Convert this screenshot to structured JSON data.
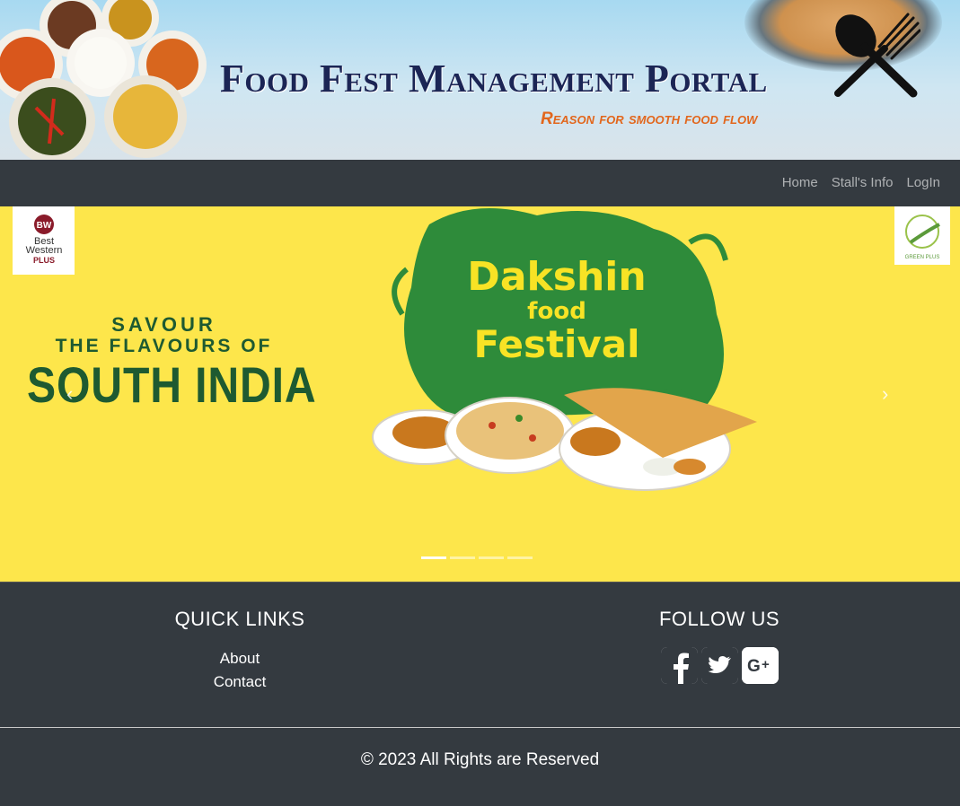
{
  "header": {
    "title": "Food Fest Management Portal",
    "subtitle": "Reason for smooth food flow"
  },
  "nav": {
    "items": [
      {
        "label": "Home"
      },
      {
        "label": "Stall's Info"
      },
      {
        "label": "LogIn"
      }
    ]
  },
  "carousel": {
    "left_logo_text": [
      "BW",
      "Best",
      "Western",
      "PLUS"
    ],
    "right_logo_text": "GREEN PLUS",
    "headline": {
      "line1": "SAVOUR",
      "line2": "THE FLAVOURS OF",
      "line3": "SOUTH INDIA"
    },
    "festival": {
      "word1": "Dakshin",
      "word2": "food",
      "word3": "Festival"
    },
    "prev_label": "‹",
    "next_label": "›",
    "slide_count": 4,
    "active_slide": 1,
    "colors": {
      "background": "#fde64b",
      "headline": "#1e5a31",
      "splash": "#2e8b3a"
    }
  },
  "footer": {
    "quick_links_title": "QUICK LINKS",
    "quick_links": [
      {
        "label": "About"
      },
      {
        "label": "Contact"
      }
    ],
    "follow_title": "FOLLOW US",
    "social_icons": [
      "facebook-icon",
      "twitter-icon",
      "google-plus-icon"
    ],
    "copyright": "© 2023 All Rights are Reserved"
  }
}
